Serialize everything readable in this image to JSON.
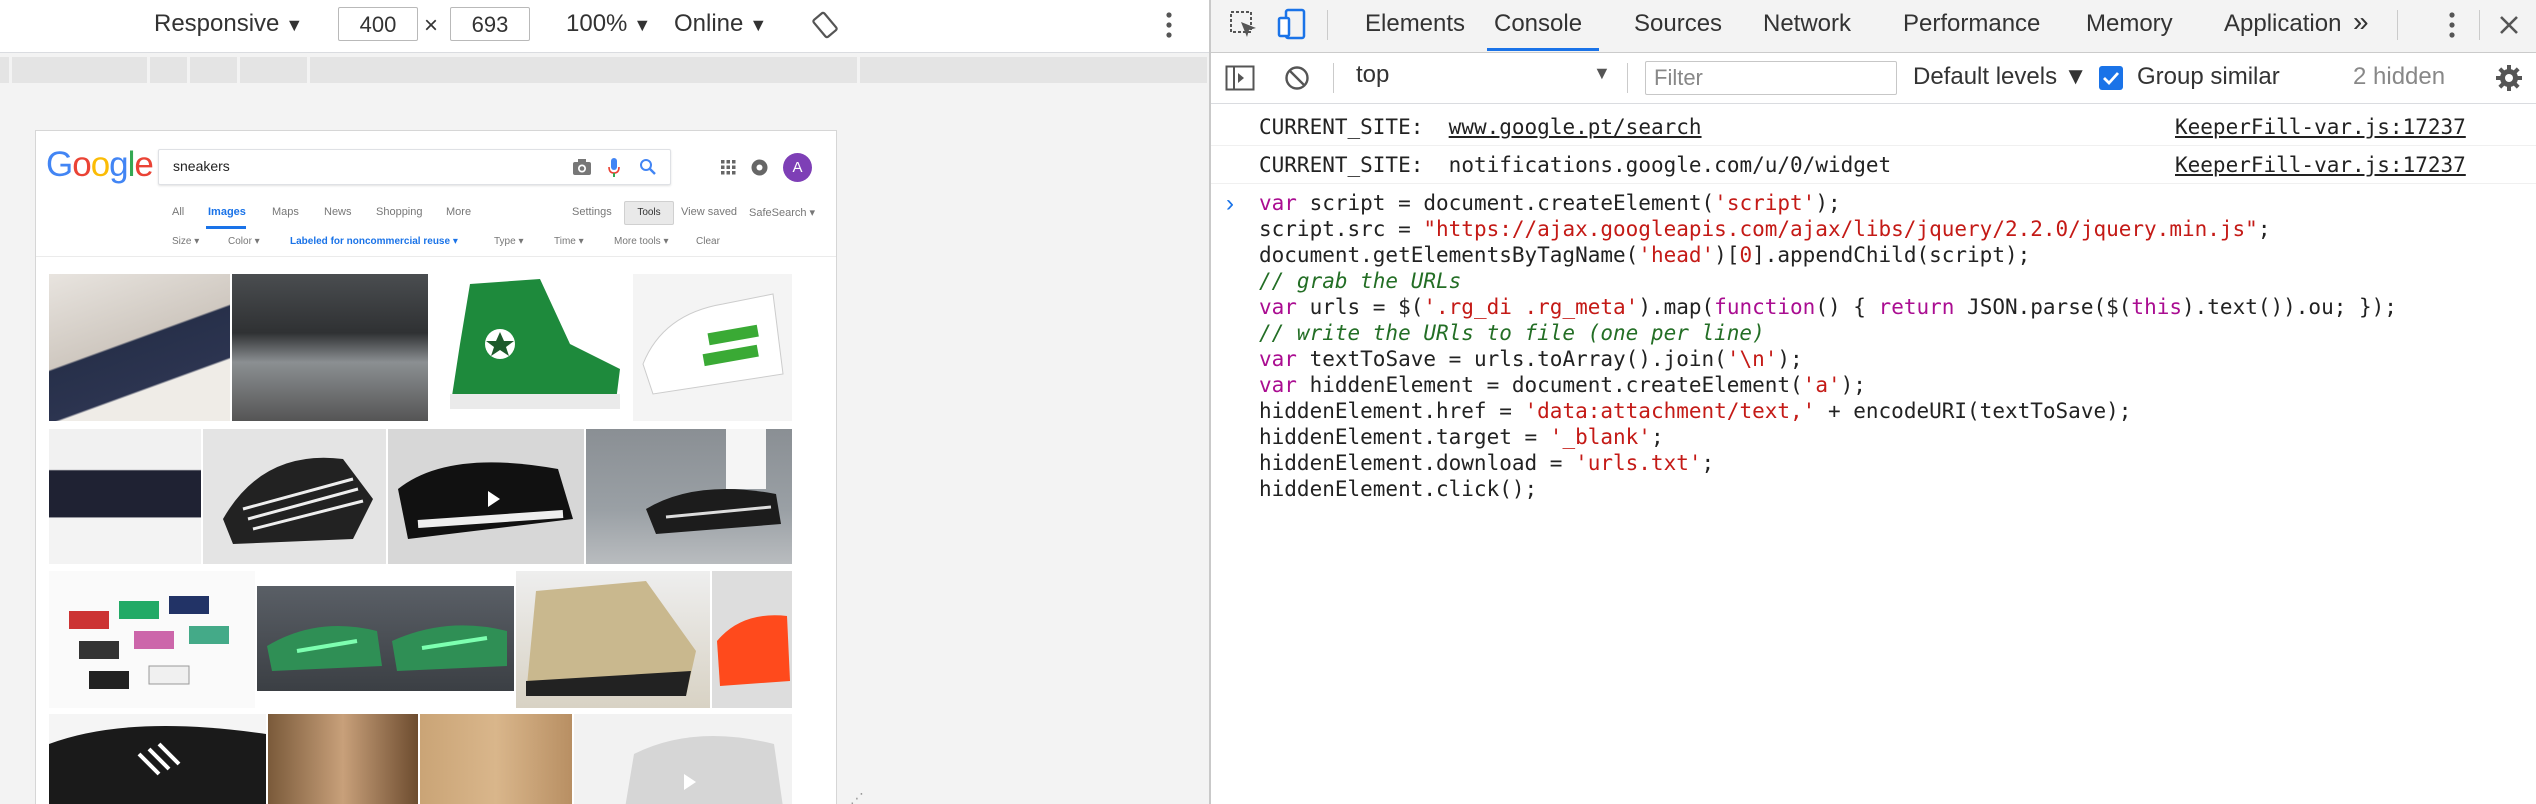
{
  "device_toolbar": {
    "device": "Responsive",
    "width": "400",
    "times": "×",
    "height": "693",
    "zoom": "100%",
    "network": "Online"
  },
  "google": {
    "logo_letters": [
      "G",
      "o",
      "o",
      "g",
      "l",
      "e"
    ],
    "logo_colors": [
      "#4285f4",
      "#ea4335",
      "#fbbc05",
      "#4285f4",
      "#34a853",
      "#ea4335"
    ],
    "query": "sneakers",
    "avatar": "A",
    "tabs": [
      "All",
      "Images",
      "Maps",
      "News",
      "Shopping",
      "More"
    ],
    "active_tab": "Images",
    "right_links": [
      "Settings",
      "Tools",
      "View saved",
      "SafeSearch ▾"
    ],
    "tools": [
      "Size ▾",
      "Color ▾",
      "Labeled for noncommercial reuse ▾",
      "Type ▾",
      "Time ▾",
      "More tools ▾",
      "Clear"
    ]
  },
  "devtools": {
    "tabs": [
      "Elements",
      "Console",
      "Sources",
      "Network",
      "Performance",
      "Memory",
      "Application"
    ],
    "active_tab": "Console",
    "more_tabs": "»",
    "context": "top",
    "filter_placeholder": "Filter",
    "levels": "Default levels ▼",
    "group_similar": "Group similar",
    "group_similar_checked": true,
    "hidden": "2 hidden",
    "logs": [
      {
        "label": "CURRENT_SITE:",
        "value": "www.google.pt/search",
        "source": "KeeperFill-var.js:17237"
      },
      {
        "label": "CURRENT_SITE:",
        "value": "notifications.google.com/u/0/widget",
        "source": "KeeperFill-var.js:17237"
      }
    ],
    "prompt": "›",
    "code_lines": [
      [
        [
          "kw",
          "var"
        ],
        [
          "op",
          " script = document.createElement("
        ],
        [
          "str",
          "'script'"
        ],
        [
          "op",
          ");"
        ]
      ],
      [
        [
          "op",
          "script.src = "
        ],
        [
          "str",
          "\"https://ajax.googleapis.com/ajax/libs/jquery/2.2.0/jquery.min.js\""
        ],
        [
          "op",
          ";"
        ]
      ],
      [
        [
          "op",
          "document.getElementsByTagName("
        ],
        [
          "str",
          "'head'"
        ],
        [
          "op",
          ")["
        ],
        [
          "str",
          "0"
        ],
        [
          "op",
          "].appendChild(script);"
        ]
      ],
      [
        [
          "cm",
          "// grab the URLs"
        ]
      ],
      [
        [
          "kw",
          "var"
        ],
        [
          "op",
          " urls = $("
        ],
        [
          "str",
          "'.rg_di .rg_meta'"
        ],
        [
          "op",
          ").map("
        ],
        [
          "kw",
          "function"
        ],
        [
          "op",
          "() { "
        ],
        [
          "kw",
          "return"
        ],
        [
          "op",
          " JSON.parse($("
        ],
        [
          "kw",
          "this"
        ],
        [
          "op",
          ").text()).ou; });"
        ]
      ],
      [
        [
          "cm",
          "// write the URls to file (one per line)"
        ]
      ],
      [
        [
          "kw",
          "var"
        ],
        [
          "op",
          " textToSave = urls.toArray().join("
        ],
        [
          "str",
          "'\\n'"
        ],
        [
          "op",
          ");"
        ]
      ],
      [
        [
          "kw",
          "var"
        ],
        [
          "op",
          " hiddenElement = document.createElement("
        ],
        [
          "str",
          "'a'"
        ],
        [
          "op",
          ");"
        ]
      ],
      [
        [
          "op",
          "hiddenElement.href = "
        ],
        [
          "str",
          "'data:attachment/text,'"
        ],
        [
          "op",
          " + encodeURI(textToSave);"
        ]
      ],
      [
        [
          "op",
          "hiddenElement.target = "
        ],
        [
          "str",
          "'_blank'"
        ],
        [
          "op",
          ";"
        ]
      ],
      [
        [
          "op",
          "hiddenElement.download = "
        ],
        [
          "str",
          "'urls.txt'"
        ],
        [
          "op",
          ";"
        ]
      ],
      [
        [
          "op",
          "hiddenElement.click();"
        ]
      ]
    ]
  }
}
